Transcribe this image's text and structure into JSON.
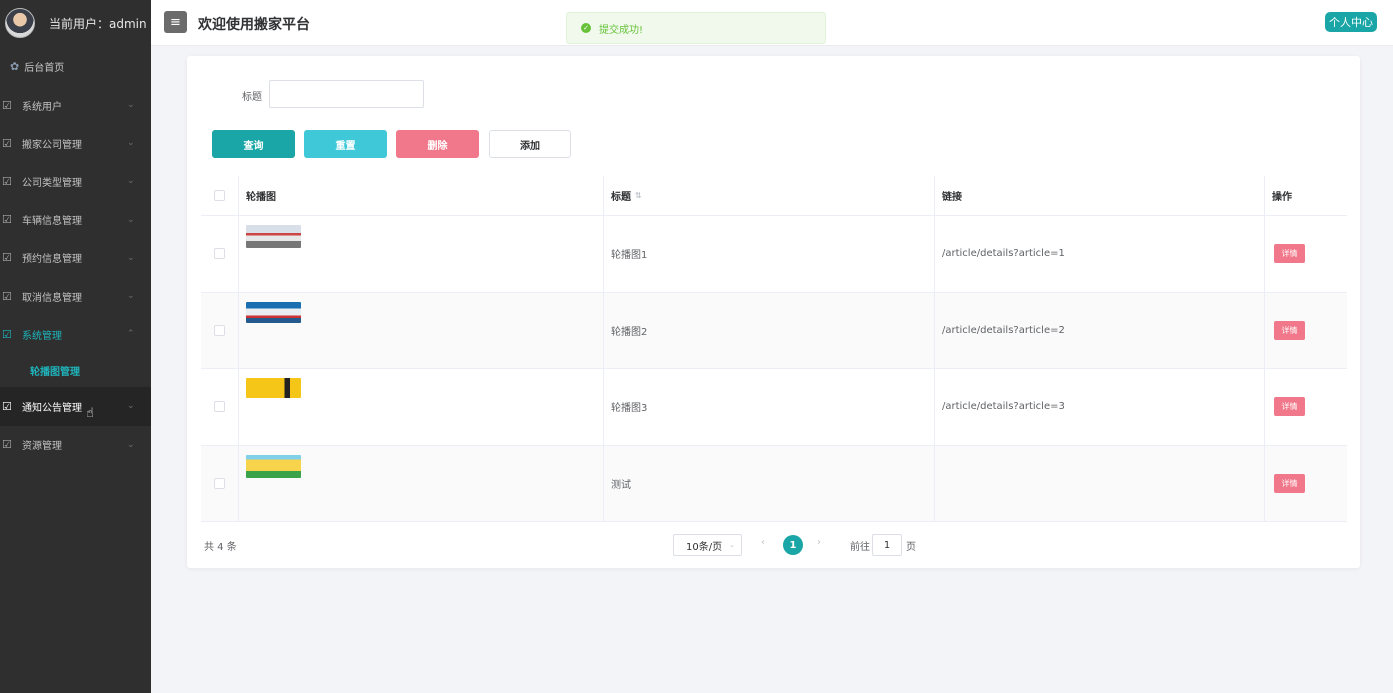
{
  "sidebar": {
    "user_text": "当前用户：admin",
    "home": {
      "label": "后台首页",
      "icon": "home-flower-icon"
    },
    "items": [
      {
        "label": "系统用户",
        "icon": "edit-icon"
      },
      {
        "label": "搬家公司管理",
        "icon": "edit-icon"
      },
      {
        "label": "公司类型管理",
        "icon": "edit-icon"
      },
      {
        "label": "车辆信息管理",
        "icon": "edit-icon"
      },
      {
        "label": "预约信息管理",
        "icon": "edit-icon"
      },
      {
        "label": "取消信息管理",
        "icon": "edit-icon"
      },
      {
        "label": "系统管理",
        "icon": "edit-icon",
        "state": "active-open"
      },
      {
        "label": "通知公告管理",
        "icon": "edit-icon",
        "state": "hover"
      },
      {
        "label": "资源管理",
        "icon": "edit-icon"
      }
    ],
    "sub_item": "轮播图管理"
  },
  "header": {
    "title": "欢迎使用搬家平台",
    "menu_icon": "hamburger-menu-icon",
    "personal_center": "个人中心"
  },
  "toast": {
    "message": "提交成功!",
    "color": "#67c23a"
  },
  "search": {
    "label": "标题",
    "value": ""
  },
  "buttons": {
    "query": "查询",
    "reset": "重置",
    "delete": "删除",
    "add": "添加"
  },
  "table": {
    "headers": {
      "image": "轮播图",
      "title": "标题",
      "link": "链接",
      "op": "操作"
    },
    "rows": [
      {
        "title": "轮播图1",
        "link": "/article/details?article=1",
        "action": "详情"
      },
      {
        "title": "轮播图2",
        "link": "/article/details?article=2",
        "action": "详情"
      },
      {
        "title": "轮播图3",
        "link": "/article/details?article=3",
        "action": "详情"
      },
      {
        "title": "测试",
        "link": "",
        "action": "详情"
      }
    ]
  },
  "pagination": {
    "total": "共 4 条",
    "page_size": "10条/页",
    "current_page": "1",
    "goto_label": "前往",
    "goto_value": "1",
    "page_suffix": "页"
  },
  "colors": {
    "accent": "#1aa6a6",
    "danger": "#f0788a",
    "sidebar_bg": "#2f2f2f",
    "sidebar_active": "#1fb4bb"
  }
}
